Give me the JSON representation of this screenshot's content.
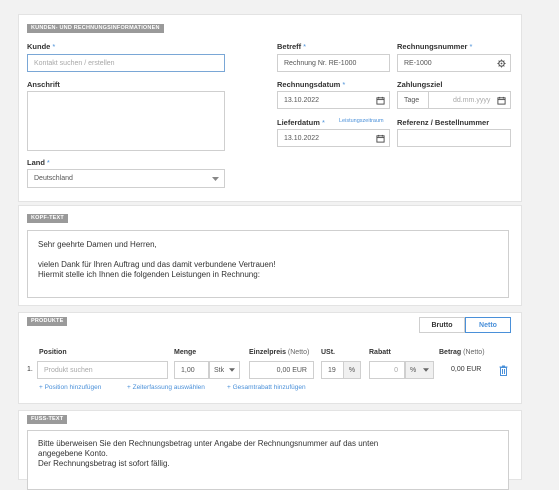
{
  "customer_section": {
    "label": "KUNDEN- UND RECHNUNGSINFORMATIONEN",
    "customer": {
      "label": "Kunde",
      "required": "*",
      "placeholder": "Kontakt suchen / erstellen"
    },
    "address": {
      "label": "Anschrift"
    },
    "country": {
      "label": "Land",
      "required": "*",
      "value": "Deutschland"
    },
    "subject": {
      "label": "Betreff",
      "required": "*",
      "value": "Rechnung Nr. RE-1000"
    },
    "invoice_number": {
      "label": "Rechnungsnummer",
      "required": "*",
      "value": "RE-1000"
    },
    "invoice_date": {
      "label": "Rechnungsdatum",
      "required": "*",
      "value": "13.10.2022"
    },
    "payment_term": {
      "label": "Zahlungsziel",
      "days_placeholder": "Tage",
      "date_placeholder": "dd.mm.yyyy"
    },
    "delivery_date": {
      "label": "Lieferdatum",
      "required": "*",
      "link": "Leistungszeitraum",
      "value": "13.10.2022"
    },
    "reference": {
      "label": "Referenz / Bestellnummer",
      "value": ""
    }
  },
  "header_text": {
    "label": "KOPF-TEXT",
    "body": "Sehr geehrte Damen und Herren,\n\nvielen Dank für Ihren Auftrag und das damit verbundene Vertrauen!\nHiermit stelle ich Ihnen die folgenden Leistungen in Rechnung:"
  },
  "products": {
    "label": "PRODUKTE",
    "toggle": {
      "brutto": "Brutto",
      "netto": "Netto",
      "active": "netto"
    },
    "columns": {
      "position": "Position",
      "quantity": "Menge",
      "unit_price": "Einzelpreis",
      "unit_price_note": "(Netto)",
      "vat": "USt.",
      "discount": "Rabatt",
      "amount": "Betrag",
      "amount_note": "(Netto)"
    },
    "row": {
      "index": "1.",
      "product_placeholder": "Produkt suchen",
      "quantity": "1,00",
      "unit": "Stk",
      "unit_price": "0,00 EUR",
      "vat": "19",
      "vat_unit": "%",
      "discount": "0",
      "discount_unit": "%",
      "amount": "0,00 EUR"
    },
    "links": {
      "add_position": "+ Position hinzufügen",
      "add_time": "+ Zeiterfassung auswählen",
      "add_total_discount": "+ Gesamtrabatt hinzufügen"
    }
  },
  "footer_text": {
    "label": "FUSS-TEXT",
    "body": "Bitte überweisen Sie den Rechnungsbetrag unter Angabe der Rechnungsnummer auf das unten\nangegebene Konto.\nDer Rechnungsbetrag ist sofort fällig."
  },
  "colors": {
    "accent": "#4a90d9",
    "label_bg": "#9a9a9a",
    "page_bg": "#f2f2f2"
  }
}
